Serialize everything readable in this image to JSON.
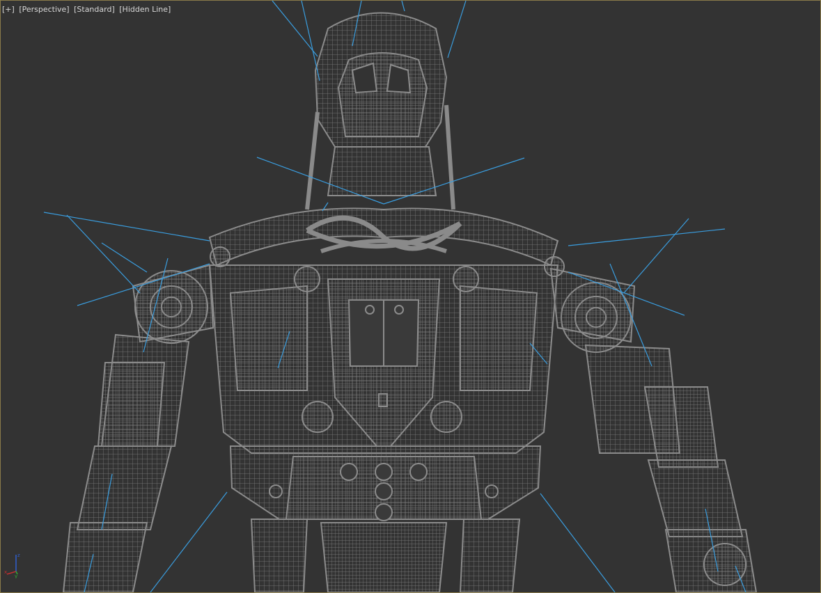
{
  "viewport": {
    "labels": {
      "plus": "[+]",
      "view": "[Perspective]",
      "shading_style": "[Standard]",
      "render_mode": "[Hidden Line]"
    },
    "gizmo": {
      "axes": [
        "x",
        "y",
        "z"
      ],
      "colors": {
        "x": "#c03030",
        "y": "#30b030",
        "z": "#3060d0"
      }
    }
  },
  "colors": {
    "background": "#333333",
    "wireframe": "#8c8c8c",
    "bones": "#3a9ee0",
    "border": "#8a7c4a"
  }
}
